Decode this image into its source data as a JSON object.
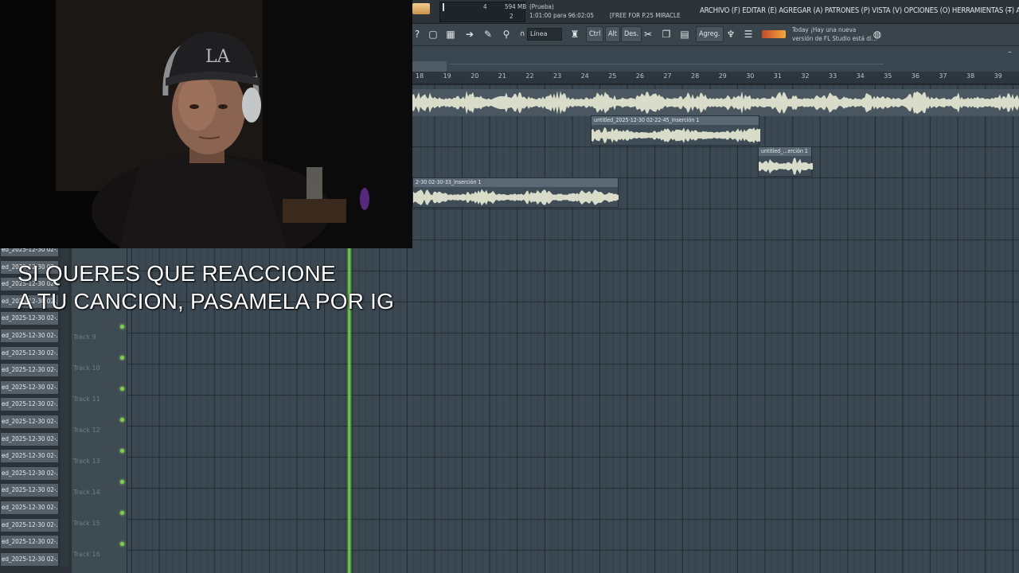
{
  "app": {
    "title_status": "(Prueba)",
    "song_position": "1:01:00 para 96:02:05",
    "memory": "594 MB",
    "cpu_top": "4",
    "cpu_bottom": "2",
    "hint_text": "[FREE FOR P.25  MIRACLE",
    "menu": "ARCHIVO (F) EDITAR (E) AGREGAR (A) PATRONES (P) VISTA (V) OPCIONES (O) HERRAMIENTAS (T) AYUDA",
    "minimize": "–"
  },
  "toolbar": {
    "snap": "Línea",
    "ctrl_label": "Ctrl",
    "alt_label": "Alt",
    "des_label": "Des.",
    "agreg_label": "Agreg.",
    "question": "?",
    "news_title": "Today ¡Hay una nueva",
    "news_body": "versión de FL Studio está di..."
  },
  "ruler": {
    "numbers": [
      "18",
      "19",
      "20",
      "21",
      "22",
      "23",
      "24",
      "25",
      "26",
      "27",
      "28",
      "29",
      "30",
      "31",
      "32",
      "33",
      "34",
      "35",
      "36",
      "37",
      "38",
      "39"
    ]
  },
  "clips": [
    {
      "label": "untitled_2025-12-30 02-22-45_Inserción 1"
    },
    {
      "label": "untitled_...erción 1"
    },
    {
      "label": "2-30 02-30-33_Inserción 1"
    }
  ],
  "tracks": [
    {
      "label": "Track 9"
    },
    {
      "label": "Track 10"
    },
    {
      "label": "Track 11"
    },
    {
      "label": "Track 12"
    },
    {
      "label": "Track 13"
    },
    {
      "label": "Track 14"
    },
    {
      "label": "Track 15"
    },
    {
      "label": "Track 16"
    }
  ],
  "browser": {
    "items": [
      "ed_2025-12-30 02-...",
      "ed_2025-12-30 02-...",
      "ed_2025-12-30 02-...",
      "ed_2025-12-30 02-...",
      "ed_2025-12-30 02-...",
      "ed_2025-12-30 02-...",
      "ed_2025-12-30 02-...",
      "ed_2025-12-30 02-...",
      "ed_2025-12-30 02-...",
      "ed_2025-12-30 02-...",
      "ed_2025-12-30 02-...",
      "ed_2025-12-30 02-...",
      "ed_2025-12-30 02-...",
      "ed_2025-12-30 02-...",
      "ed_2025-12-30 02-...",
      "ed_2025-12-30 02-...",
      "ed_2025-12-30 02-...",
      "ed_2025-12-30 02-...",
      "ed_2025-12-30 02-..."
    ]
  },
  "overlay": {
    "caption_line1": "SI QUERES QUE REACCIONE",
    "caption_line2": "A TU CANCION, PASAMELA POR IG",
    "cap_logo": "LA"
  },
  "colors": {
    "playhead": "#7ae84a",
    "wave": "#d9dcc8",
    "led": "#7fd14a"
  }
}
